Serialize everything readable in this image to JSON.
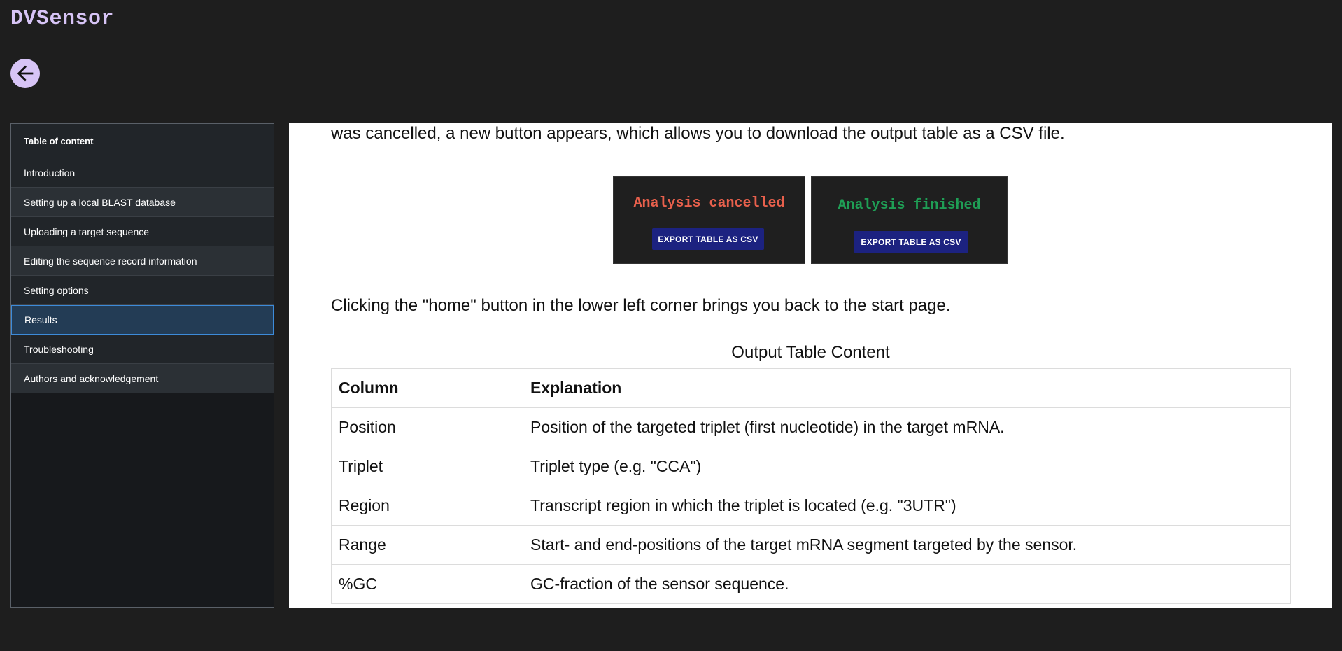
{
  "app": {
    "title": "DVSensor"
  },
  "toc": {
    "header": "Table of content",
    "items": [
      {
        "label": "Introduction"
      },
      {
        "label": "Setting up a local BLAST database"
      },
      {
        "label": "Uploading a target sequence"
      },
      {
        "label": "Editing the sequence record information"
      },
      {
        "label": "Setting options"
      },
      {
        "label": "Results"
      },
      {
        "label": "Troubleshooting"
      },
      {
        "label": "Authors and acknowledgement"
      }
    ],
    "active_index": 5
  },
  "content": {
    "para1": "was cancelled, a new button appears, which allows you to download the output table as a CSV file.",
    "shot_cancelled": {
      "title": "Analysis cancelled",
      "button": "EXPORT TABLE AS CSV",
      "title_color": "#e8604c"
    },
    "shot_finished": {
      "title": "Analysis finished",
      "button": "EXPORT TABLE AS CSV",
      "title_color": "#1f9e55"
    },
    "para2": "Clicking the \"home\" button in the lower left corner brings you back to the start page.",
    "table": {
      "caption": "Output Table Content",
      "headers": [
        "Column",
        "Explanation"
      ],
      "rows": [
        [
          "Position",
          "Position of the targeted triplet (first nucleotide) in the target mRNA."
        ],
        [
          "Triplet",
          "Triplet type (e.g. \"CCA\")"
        ],
        [
          "Region",
          "Transcript region in which the triplet is located (e.g. \"3UTR\")"
        ],
        [
          "Range",
          "Start- and end-positions of the target mRNA segment targeted by the sensor."
        ],
        [
          "%GC",
          "GC-fraction of the sensor sequence."
        ]
      ]
    }
  },
  "colors": {
    "accent": "#d7c4f6",
    "background": "#1e1e1e",
    "active_item": "#233c55"
  }
}
